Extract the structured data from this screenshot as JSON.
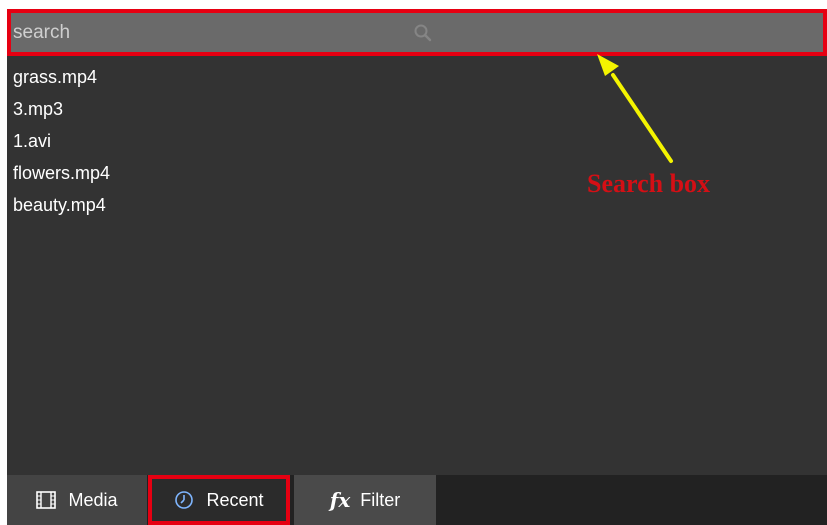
{
  "search": {
    "placeholder": "search"
  },
  "files": [
    "grass.mp4",
    "3.mp3",
    "1.avi",
    "flowers.mp4",
    "beauty.mp4"
  ],
  "annotation": {
    "label": "Search box"
  },
  "tabs": {
    "media": "Media",
    "recent": "Recent",
    "filter": "Filter"
  },
  "colors": {
    "highlight": "#e60012",
    "arrow": "#f4f400",
    "annotation_text": "#d40f15"
  },
  "icons": {
    "search": "search-icon",
    "media": "film-icon",
    "recent": "clock-icon",
    "filter": "fx-icon"
  }
}
